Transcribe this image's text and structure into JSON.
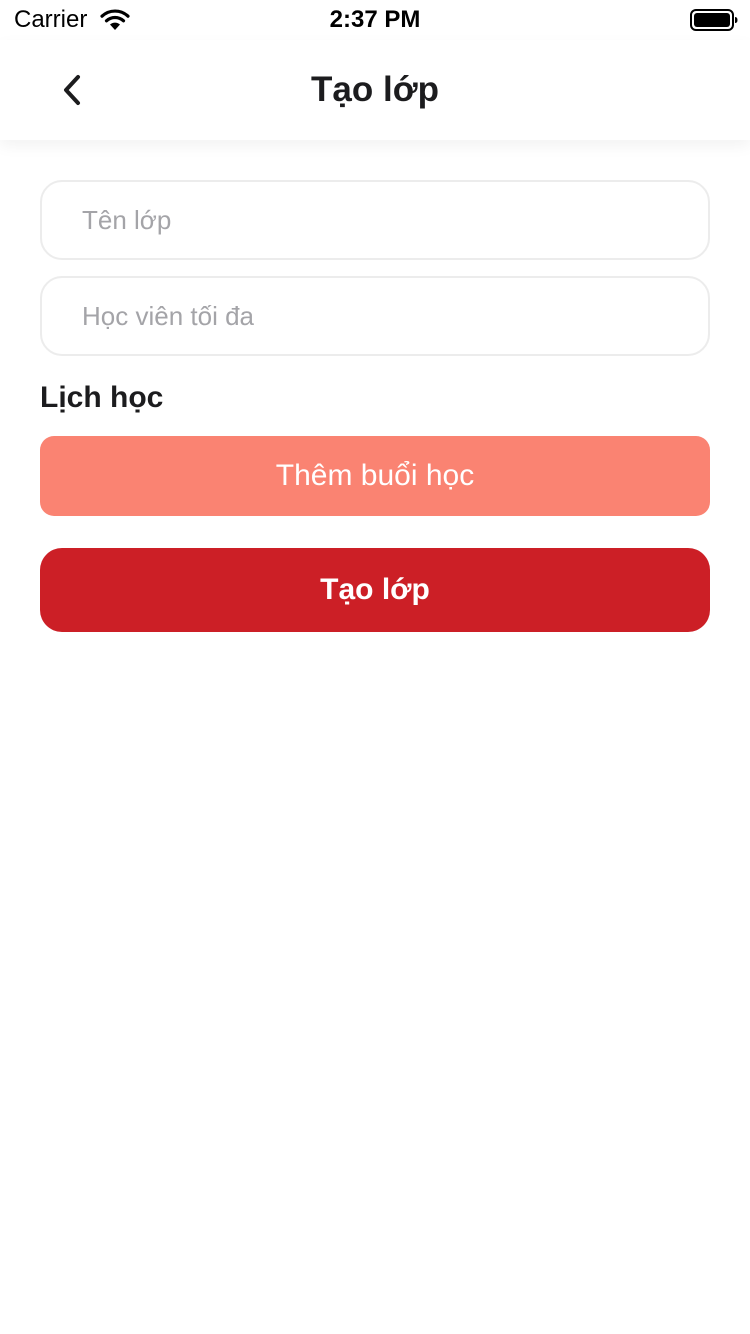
{
  "status_bar": {
    "carrier": "Carrier",
    "time": "2:37 PM",
    "wifi_icon": "wifi-icon",
    "battery_icon": "battery-icon"
  },
  "nav": {
    "back_icon": "chevron-left-icon",
    "title": "Tạo lớp"
  },
  "form": {
    "class_name": {
      "placeholder": "Tên lớp",
      "value": ""
    },
    "max_students": {
      "placeholder": "Học viên tối đa",
      "value": ""
    },
    "schedule_label": "Lịch học",
    "add_session_label": "Thêm buổi học",
    "create_label": "Tạo lớp"
  },
  "colors": {
    "add_session_bg": "#fa8372",
    "create_bg": "#cc1f26",
    "field_border": "#ececec",
    "placeholder": "#a4a4a8"
  }
}
